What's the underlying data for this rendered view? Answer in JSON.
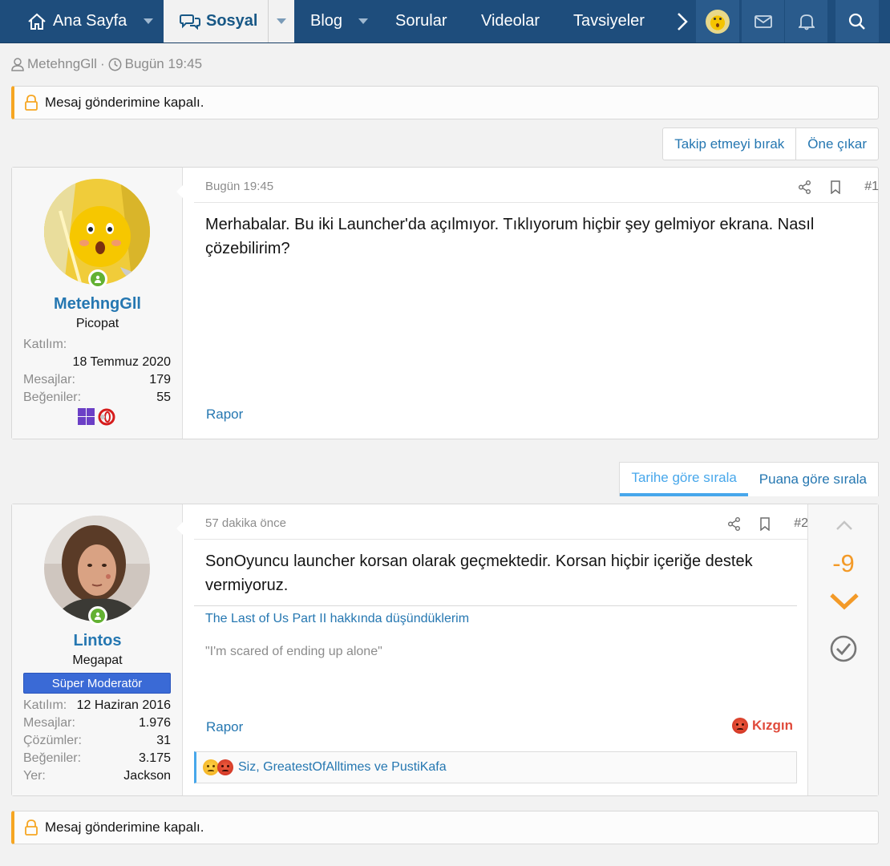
{
  "nav": {
    "home_label": "Ana Sayfa",
    "social_label": "Sosyal",
    "blog_label": "Blog",
    "questions_label": "Sorular",
    "videos_label": "Videolar",
    "recommendations_label": "Tavsiyeler",
    "colors": {
      "bar": "#1e4d7c",
      "selected_tab": "#f2f2f2",
      "selected_text": "#185886"
    }
  },
  "thread_meta": {
    "author": "MetehngGll",
    "separator": "·",
    "time": "Bugün 19:45"
  },
  "notice": {
    "text": "Mesaj gönderimine kapalı.",
    "accent": "#f6a623"
  },
  "actions": {
    "unwatch_label": "Takip etmeyi bırak",
    "feature_label": "Öne çıkar"
  },
  "posts": [
    {
      "user": {
        "name": "MetehngGll",
        "title": "Picopat",
        "joined_label": "Katılım:",
        "joined_value": "18 Temmuz 2020",
        "messages_label": "Mesajlar:",
        "messages_value": "179",
        "likes_label": "Beğeniler:",
        "likes_value": "55"
      },
      "time": "Bugün 19:45",
      "number": "#1",
      "text": "Merhabalar. Bu iki Launcher'da açılmıyor. Tıklıyorum hiçbir şey gelmiyor ekrana. Nasıl çözebilirim?",
      "report_label": "Rapor"
    },
    {
      "user": {
        "name": "Lintos",
        "title": "Megapat",
        "badge": "Süper Moderatör",
        "joined_label": "Katılım:",
        "joined_value": "12 Haziran 2016",
        "messages_label": "Mesajlar:",
        "messages_value": "1.976",
        "solutions_label": "Çözümler:",
        "solutions_value": "31",
        "likes_label": "Beğeniler:",
        "likes_value": "3.175",
        "location_label": "Yer:",
        "location_value": "Jackson"
      },
      "time": "57 dakika önce",
      "number": "#2",
      "text": "SonOyuncu launcher korsan olarak geçmektedir. Korsan hiçbir içeriğe destek vermiyoruz.",
      "signature_link": "The Last of Us Part II hakkında düşündüklerim",
      "signature_quote": "\"I'm scared of ending up alone\"",
      "report_label": "Rapor",
      "reaction_label": "Kızgın",
      "reactions_text": "Siz, GreatestOfAlltimes ve PustiKafa",
      "vote_score": "-9"
    }
  ],
  "sort": {
    "by_date": "Tarihe göre sırala",
    "by_score": "Puana göre sırala"
  }
}
